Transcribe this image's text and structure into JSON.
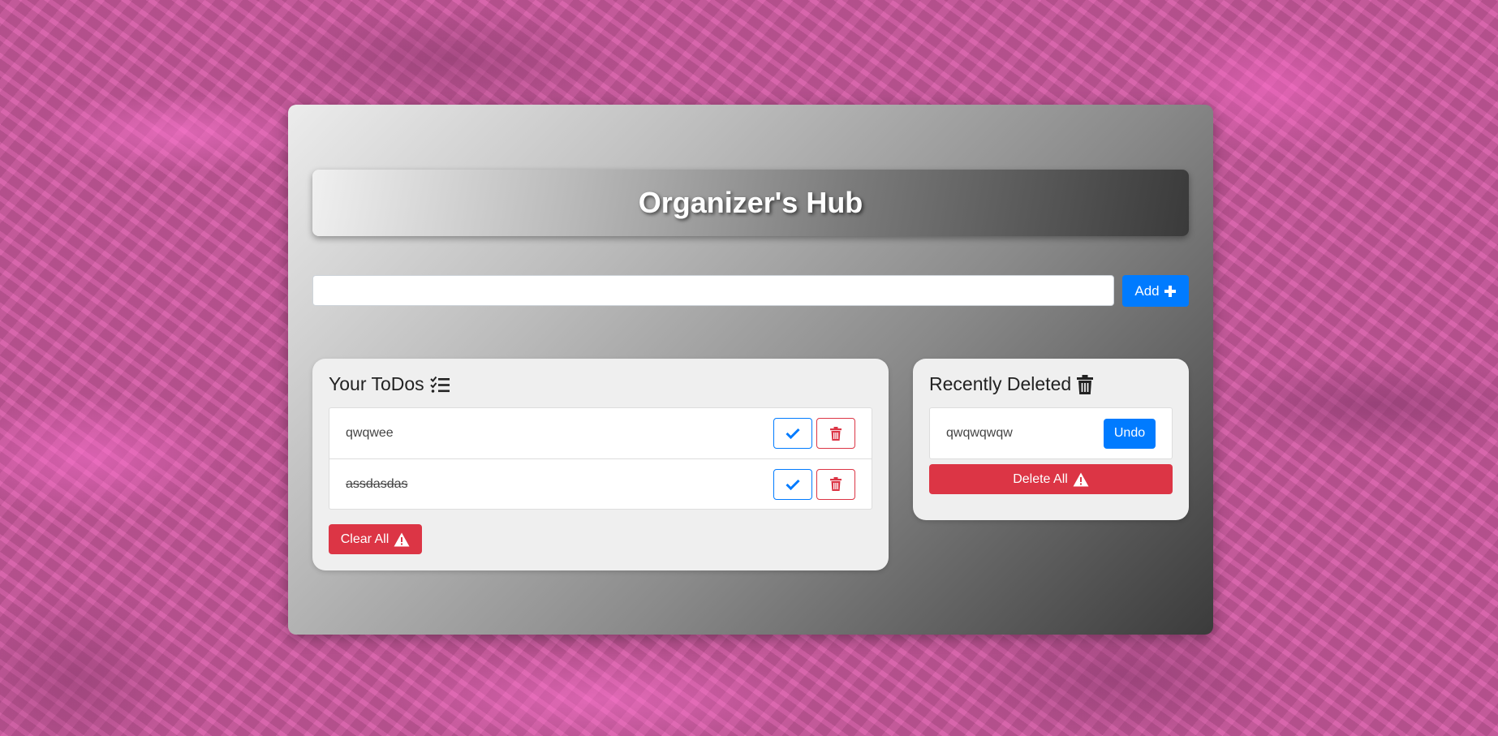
{
  "header": {
    "title": "Organizer's Hub"
  },
  "input": {
    "value": "",
    "placeholder": ""
  },
  "add_button": {
    "label": "Add",
    "icon": "plus-icon"
  },
  "todos": {
    "title": "Your ToDos",
    "title_icon": "checklist-icon",
    "items": [
      {
        "text": "qwqwee",
        "completed": false
      },
      {
        "text": "assdasdas",
        "completed": true
      }
    ],
    "clear_all_label": "Clear All",
    "clear_all_icon": "warning-icon"
  },
  "recently_deleted": {
    "title": "Recently Deleted",
    "title_icon": "trash-icon",
    "items": [
      {
        "text": "qwqwqwqw",
        "undo_label": "Undo"
      }
    ],
    "delete_all_label": "Delete All",
    "delete_all_icon": "warning-icon"
  },
  "colors": {
    "primary": "#007bff",
    "danger": "#dc3545",
    "background": "#c85a9a"
  }
}
